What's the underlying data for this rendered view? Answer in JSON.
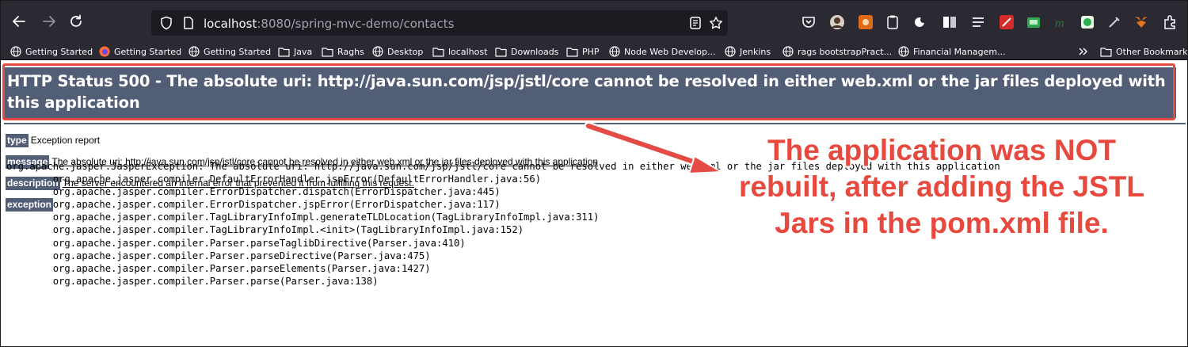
{
  "browser": {
    "url_host": "localhost",
    "url_rest": ":8080/spring-mvc-demo/contacts",
    "bookmarks": [
      {
        "label": "Getting Started",
        "icon": "globe-icon"
      },
      {
        "label": "Getting Started",
        "icon": "firefox-icon"
      },
      {
        "label": "Getting Started",
        "icon": "globe-icon"
      },
      {
        "label": "Java",
        "icon": "folder-icon"
      },
      {
        "label": "Raghs",
        "icon": "folder-icon"
      },
      {
        "label": "Desktop",
        "icon": "globe-icon"
      },
      {
        "label": "localhost",
        "icon": "folder-icon"
      },
      {
        "label": "Downloads",
        "icon": "folder-icon"
      },
      {
        "label": "PHP",
        "icon": "folder-icon"
      },
      {
        "label": "Node Web Develop...",
        "icon": "globe-icon"
      },
      {
        "label": "Jenkins",
        "icon": "globe-icon"
      },
      {
        "label": "rags bootstrapPract...",
        "icon": "globe-icon"
      },
      {
        "label": "Financial Managem...",
        "icon": "globe-icon"
      }
    ],
    "other_bookmarks": "Other Bookmarks"
  },
  "page": {
    "title": "HTTP Status 500 - The absolute uri: http://java.sun.com/jsp/jstl/core cannot be resolved in either web.xml or the jar files deployed with this application",
    "type_label": "type",
    "type_value": "Exception report",
    "message_label": "message",
    "message_value": "The absolute uri: http://java.sun.com/jsp/jstl/core cannot be resolved in either web.xml or the jar files deployed with this application",
    "description_label": "description",
    "description_value": "The server encountered an internal error that prevented it from fulfilling this request.",
    "exception_label": "exception",
    "stack_trace": [
      "org.apache.jasper.JasperException: The absolute uri: http://java.sun.com/jsp/jstl/core cannot be resolved in either web.xml or the jar files deployed with this application",
      "\torg.apache.jasper.compiler.DefaultErrorHandler.jspError(DefaultErrorHandler.java:56)",
      "\torg.apache.jasper.compiler.ErrorDispatcher.dispatch(ErrorDispatcher.java:445)",
      "\torg.apache.jasper.compiler.ErrorDispatcher.jspError(ErrorDispatcher.java:117)",
      "\torg.apache.jasper.compiler.TagLibraryInfoImpl.generateTLDLocation(TagLibraryInfoImpl.java:311)",
      "\torg.apache.jasper.compiler.TagLibraryInfoImpl.<init>(TagLibraryInfoImpl.java:152)",
      "\torg.apache.jasper.compiler.Parser.parseTaglibDirective(Parser.java:410)",
      "\torg.apache.jasper.compiler.Parser.parseDirective(Parser.java:475)",
      "\torg.apache.jasper.compiler.Parser.parseElements(Parser.java:1427)",
      "\torg.apache.jasper.compiler.Parser.parse(Parser.java:138)"
    ]
  },
  "annotation": {
    "callout_text": "The application was NOT rebuilt, after adding the JSTL Jars in the pom.xml file.",
    "color": "#e34b44"
  },
  "colors": {
    "banner": "#525d76",
    "chrome": "#2b2a33",
    "urlbar": "#1c1b22"
  }
}
